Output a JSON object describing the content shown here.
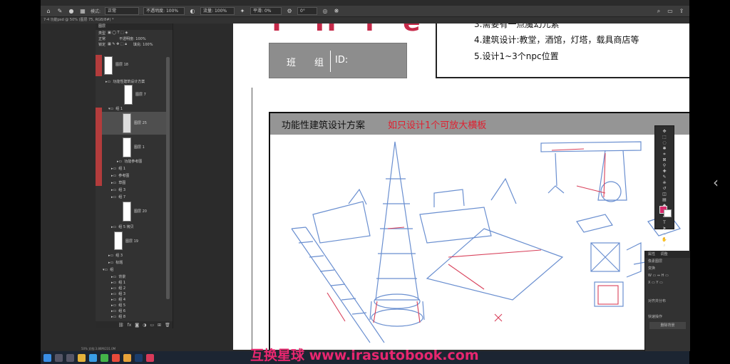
{
  "optionbar": {
    "field1": "正常",
    "field2": "不透明度: 100%",
    "field3": "流量: 100%",
    "field4": "平滑: 0%",
    "field5": "0°"
  },
  "tab": {
    "title": "7-4 功能psd @ 50% (图层 75, RGB/8#) *"
  },
  "layers": {
    "panel_title": "图层",
    "kind": "类型",
    "mode": "正常",
    "opacity": "不透明度: 100%",
    "lock": "锁定",
    "fill": "填充: 100%",
    "items": [
      {
        "name": "图层 18"
      },
      {
        "name": "功能性建筑设计方案"
      },
      {
        "name": "图层 7"
      },
      {
        "name": "组 1"
      },
      {
        "name": "图层 25"
      },
      {
        "name": "图层 1"
      },
      {
        "name": "功能参考图"
      },
      {
        "name": "组 1"
      },
      {
        "name": "参考图"
      },
      {
        "name": "草图"
      },
      {
        "name": "组 3"
      },
      {
        "name": "组 7"
      },
      {
        "name": "图层 20"
      },
      {
        "name": "组 5 拷贝"
      },
      {
        "name": "图层 19"
      },
      {
        "name": "组 3"
      },
      {
        "name": "标题"
      },
      {
        "name": "组"
      },
      {
        "name": "背景"
      },
      {
        "name": "组 1"
      },
      {
        "name": "组 2"
      },
      {
        "name": "组 3"
      },
      {
        "name": "组 4"
      },
      {
        "name": "组 5"
      },
      {
        "name": "组 6"
      },
      {
        "name": "组 8"
      },
      {
        "name": "底"
      }
    ]
  },
  "document": {
    "header_partial": "Y H i e",
    "team_label": "班　　组",
    "id_label": "ID:",
    "req3": "3.需要有一点魔幻元素",
    "req4": "4.建筑设计:教堂，酒馆，灯塔，载具商店等",
    "req5": "5.设计1~3个npc位置",
    "box_title": "功能性建筑设计方案",
    "box_note": "如只设计1个可放大横板"
  },
  "props": {
    "tab1": "属性",
    "tab2": "调整",
    "r1": "像素图层",
    "r2": "变换",
    "r3": "对齐并分布",
    "r4": "快速操作",
    "r5": "删除背景"
  },
  "status": {
    "text": "50%  文档:3.86M/231.0M"
  },
  "watermark": {
    "text": "互换星球 www.irasutobook.com"
  },
  "colors": {
    "foreground": "#d62a6b",
    "background": "#ffffff",
    "accent_red": "#e8276f"
  }
}
